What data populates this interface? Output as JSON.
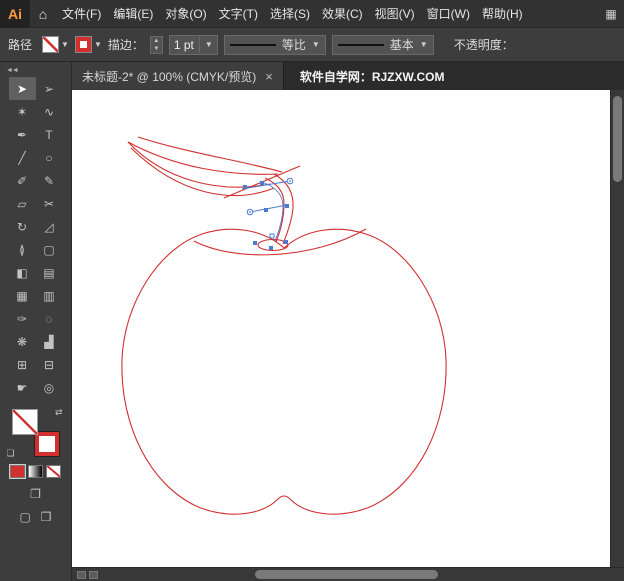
{
  "colors": {
    "artwork_red": "#d22f2f",
    "selection_blue": "#4a7bd0",
    "logo_orange": "#ff9a3c"
  },
  "icons": {
    "home": "⌂",
    "workspace_grid": "▦",
    "chevron_down": "▼",
    "stepper_up": "▲",
    "stepper_down": "▼",
    "collapse": "◄◄",
    "swap": "⇄",
    "default_swatches": "❏",
    "draw_mode": "❐",
    "screen_mode": "▢",
    "panel": "❒",
    "close": "×"
  },
  "menubar": {
    "logo": "Ai",
    "items": [
      {
        "name": "menu-file",
        "label": "文件(F)"
      },
      {
        "name": "menu-edit",
        "label": "编辑(E)"
      },
      {
        "name": "menu-object",
        "label": "对象(O)"
      },
      {
        "name": "menu-type",
        "label": "文字(T)"
      },
      {
        "name": "menu-select",
        "label": "选择(S)"
      },
      {
        "name": "menu-effect",
        "label": "效果(C)"
      },
      {
        "name": "menu-view",
        "label": "视图(V)"
      },
      {
        "name": "menu-window",
        "label": "窗口(W)"
      },
      {
        "name": "menu-help",
        "label": "帮助(H)"
      }
    ]
  },
  "controlbar": {
    "context_label": "路径",
    "stroke_label": "描边：",
    "stroke_width_value": "1 pt",
    "width_profile_value": "等比",
    "brush_value": "基本",
    "opacity_label": "不透明度："
  },
  "tabbar": {
    "document_title": "未标题-2* @ 100% (CMYK/预览)",
    "site_text": "软件自学网：RJZXW.COM"
  },
  "toolbar": {
    "tools": [
      {
        "name": "selection-tool",
        "glyph": "➤",
        "active": true
      },
      {
        "name": "direct-selection-tool",
        "glyph": "➢"
      },
      {
        "name": "magic-wand-tool",
        "glyph": "✶"
      },
      {
        "name": "lasso-tool",
        "glyph": "∿"
      },
      {
        "name": "pen-tool",
        "glyph": "✒"
      },
      {
        "name": "type-tool",
        "glyph": "T"
      },
      {
        "name": "line-segment-tool",
        "glyph": "╱"
      },
      {
        "name": "ellipse-tool",
        "glyph": "○"
      },
      {
        "name": "paintbrush-tool",
        "glyph": "✐"
      },
      {
        "name": "pencil-tool",
        "glyph": "✎"
      },
      {
        "name": "eraser-tool",
        "glyph": "▱"
      },
      {
        "name": "scissors-tool",
        "glyph": "✂"
      },
      {
        "name": "rotate-tool",
        "glyph": "↻"
      },
      {
        "name": "scale-tool",
        "glyph": "◿"
      },
      {
        "name": "width-tool",
        "glyph": "≬"
      },
      {
        "name": "free-transform-tool",
        "glyph": "▢"
      },
      {
        "name": "shape-builder-tool",
        "glyph": "◧"
      },
      {
        "name": "perspective-grid-tool",
        "glyph": "▤"
      },
      {
        "name": "mesh-tool",
        "glyph": "▦"
      },
      {
        "name": "gradient-tool",
        "glyph": "▥"
      },
      {
        "name": "eyedropper-tool",
        "glyph": "✑"
      },
      {
        "name": "blend-tool",
        "glyph": "◌"
      },
      {
        "name": "symbol-sprayer-tool",
        "glyph": "❋"
      },
      {
        "name": "column-graph-tool",
        "glyph": "▟"
      },
      {
        "name": "artboard-tool",
        "glyph": "⊞"
      },
      {
        "name": "slice-tool",
        "glyph": "⊟"
      },
      {
        "name": "hand-tool",
        "glyph": "☛"
      },
      {
        "name": "zoom-tool",
        "glyph": "◎"
      }
    ]
  }
}
